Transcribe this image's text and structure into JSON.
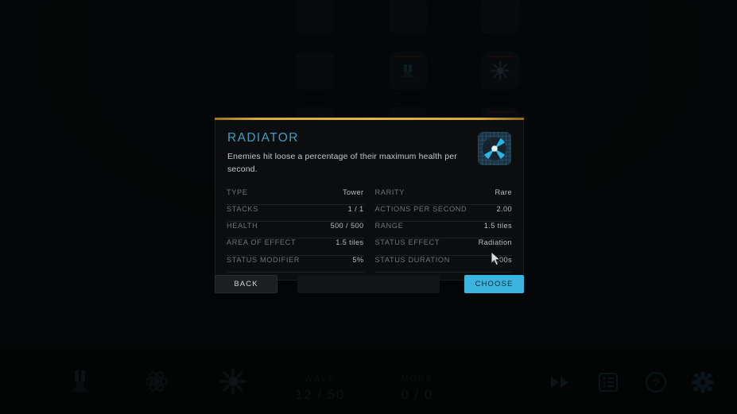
{
  "dialog": {
    "title": "RADIATOR",
    "description": "Enemies hit loose a percentage of their maximum health per second.",
    "icon": "radiation-icon",
    "accent_color": "#e3b648",
    "title_color": "#3f9ec3",
    "stats_left": [
      {
        "key": "TYPE",
        "value": "Tower"
      },
      {
        "key": "STACKS",
        "value": "1 / 1"
      },
      {
        "key": "HEALTH",
        "value": "500 / 500"
      },
      {
        "key": "AREA OF EFFECT",
        "value": "1.5 tiles"
      },
      {
        "key": "STATUS MODIFIER",
        "value": "5%"
      }
    ],
    "stats_right": [
      {
        "key": "RARITY",
        "value": "Rare"
      },
      {
        "key": "ACTIONS PER SECOND",
        "value": "2.00"
      },
      {
        "key": "RANGE",
        "value": "1.5 tiles"
      },
      {
        "key": "STATUS EFFECT",
        "value": "Radiation"
      },
      {
        "key": "STATUS DURATION",
        "value": "1.00s"
      }
    ]
  },
  "footer": {
    "back_label": "BACK",
    "choose_label": "CHOOSE",
    "choose_color": "#3bb4e0"
  },
  "hud": {
    "counters": [
      {
        "label": "WAVE",
        "value": "12 / 50"
      },
      {
        "label": "MOBS",
        "value": "0 / 0"
      }
    ],
    "buttons": [
      {
        "icon": "fast-forward-icon"
      },
      {
        "icon": "log-list-icon"
      },
      {
        "icon": "help-question-icon"
      },
      {
        "icon": "settings-gear-icon"
      }
    ],
    "towers": [
      {
        "icon": "tower-cannon-icon"
      },
      {
        "icon": "tower-atom-icon"
      },
      {
        "icon": "tower-burst-icon"
      }
    ]
  },
  "debug_readout": [
    "",
    "",
    ""
  ],
  "background_cards": [
    {
      "type": "empty"
    },
    {
      "type": "empty"
    },
    {
      "type": "empty"
    },
    {
      "type": "empty"
    },
    {
      "type": "tower-cannon-icon"
    },
    {
      "type": "tower-burst-icon"
    },
    {
      "type": "empty"
    },
    {
      "type": "empty"
    },
    {
      "type": "tower-generic-icon"
    }
  ]
}
